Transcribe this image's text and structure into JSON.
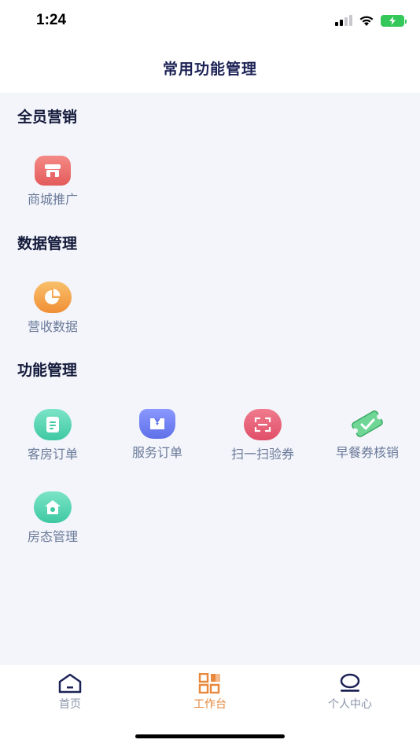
{
  "status_bar": {
    "time": "1:24"
  },
  "nav": {
    "title": "常用功能管理"
  },
  "sections": [
    {
      "title": "全员营销",
      "items": [
        {
          "label": "商城推广",
          "icon": "store-icon",
          "color": "#ee6a6a"
        }
      ]
    },
    {
      "title": "数据管理",
      "items": [
        {
          "label": "营收数据",
          "icon": "pie-chart-icon",
          "color": "#f4a24a"
        }
      ]
    },
    {
      "title": "功能管理",
      "items": [
        {
          "label": "客房订单",
          "icon": "document-icon",
          "color": "#4fd4b0"
        },
        {
          "label": "服务订单",
          "icon": "service-bag-icon",
          "color": "#6b7bf0"
        },
        {
          "label": "扫一扫验券",
          "icon": "scan-icon",
          "color": "#ea6077"
        },
        {
          "label": "早餐券核销",
          "icon": "ticket-check-icon",
          "color": "#4cc27a"
        },
        {
          "label": "房态管理",
          "icon": "house-icon",
          "color": "#4fd4b0"
        }
      ]
    }
  ],
  "tabs": [
    {
      "label": "首页",
      "icon": "home-icon",
      "active": false
    },
    {
      "label": "工作台",
      "icon": "grid-icon",
      "active": true
    },
    {
      "label": "个人中心",
      "icon": "profile-icon",
      "active": false
    }
  ],
  "colors": {
    "active_tab": "#e8893e",
    "inactive_tab": "#8a93a8",
    "title": "#1c2255",
    "background": "#f3f5fb"
  }
}
